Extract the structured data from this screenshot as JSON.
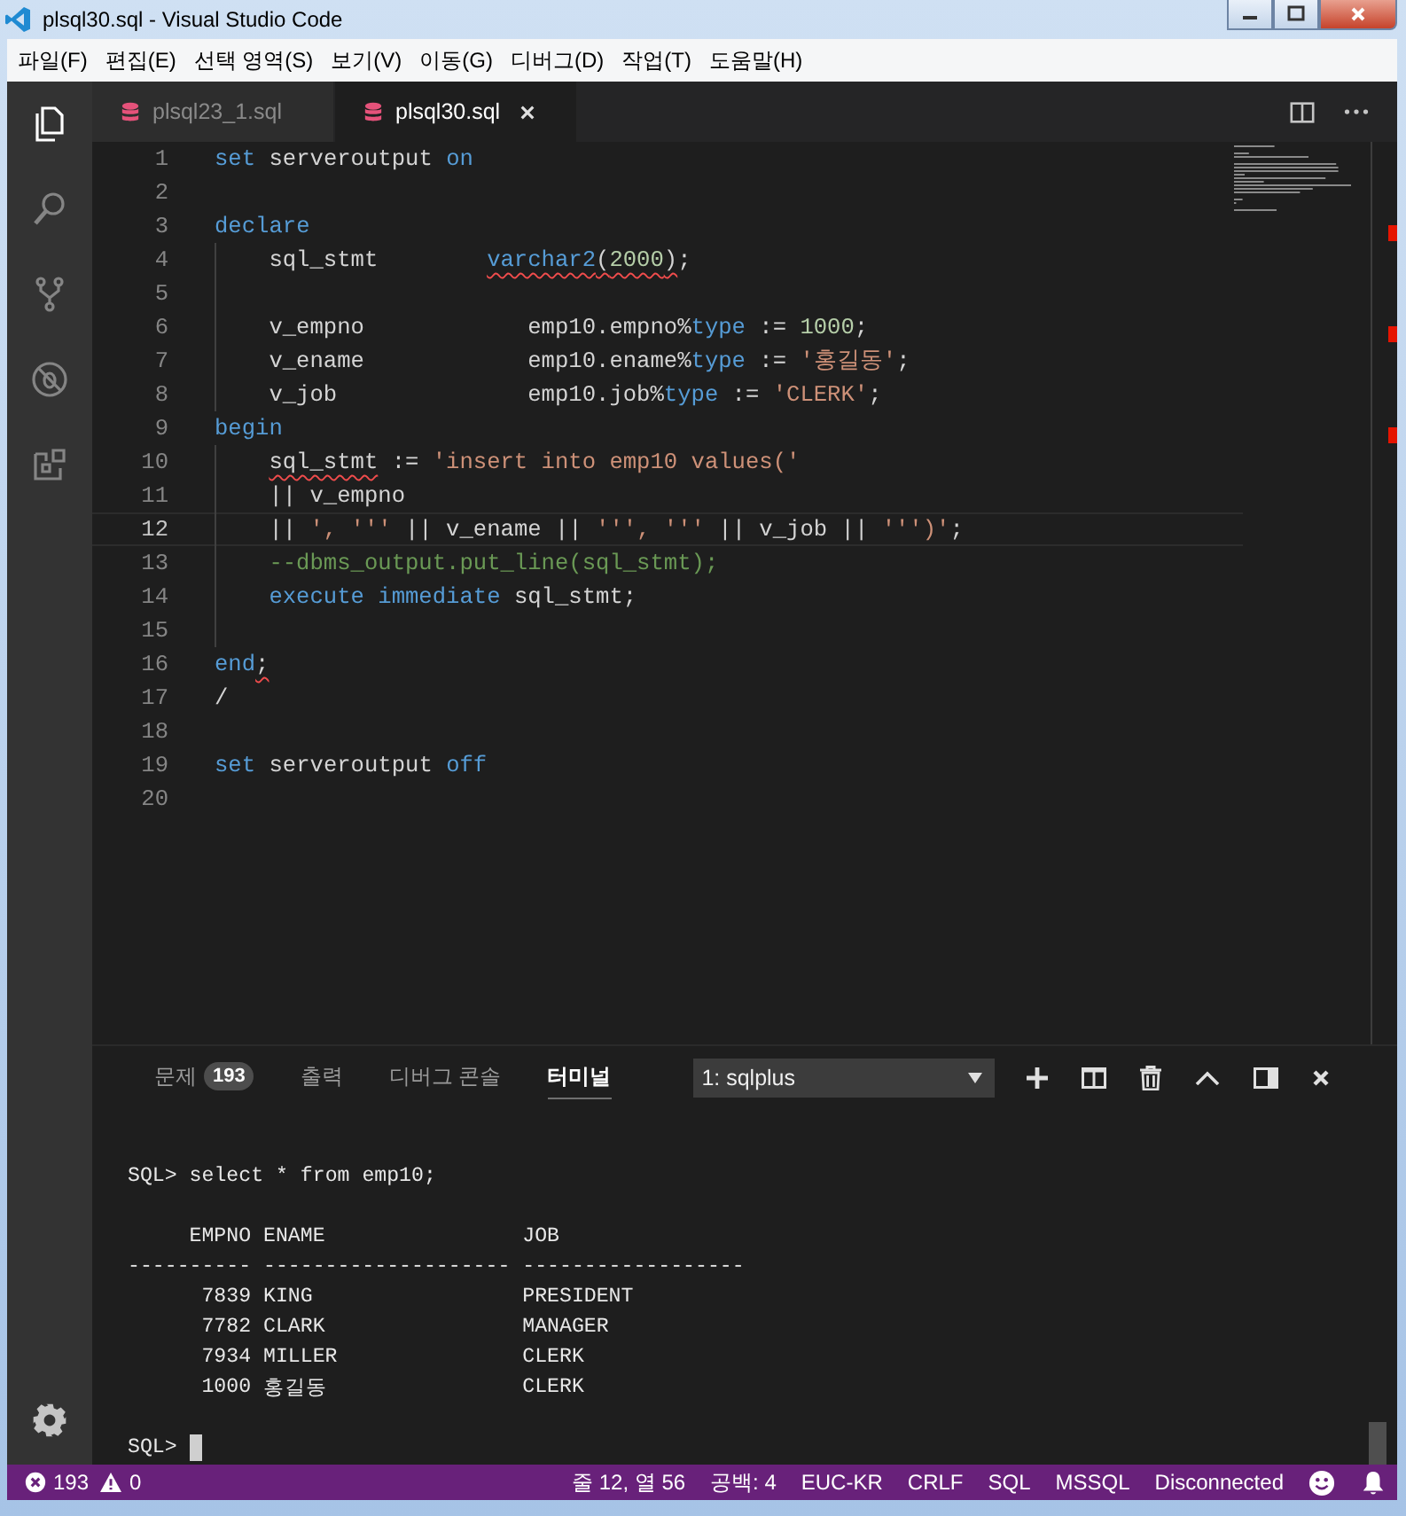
{
  "window": {
    "title": "plsql30.sql - Visual Studio Code"
  },
  "menu": [
    "파일(F)",
    "편집(E)",
    "선택 영역(S)",
    "보기(V)",
    "이동(G)",
    "디버그(D)",
    "작업(T)",
    "도움말(H)"
  ],
  "activity_bar": {
    "items": [
      {
        "selected": true
      },
      {
        "selected": false
      },
      {
        "selected": false
      },
      {
        "selected": false
      },
      {
        "selected": false
      }
    ]
  },
  "tabs": [
    {
      "label": "plsql23_1.sql",
      "selected": false
    },
    {
      "label": "plsql30.sql",
      "selected": true
    }
  ],
  "editor": {
    "lines": [
      {
        "n": "1",
        "current": false,
        "guide": false,
        "tokens": [
          {
            "t": "set",
            "kind": "kw",
            "error": false
          },
          {
            "t": " serveroutput ",
            "kind": "id",
            "error": false
          },
          {
            "t": "on",
            "kind": "kw",
            "error": false
          }
        ]
      },
      {
        "n": "2",
        "current": false,
        "guide": false
      },
      {
        "n": "3",
        "current": false,
        "guide": false,
        "tokens": [
          {
            "t": "declare",
            "kind": "kw",
            "error": false
          }
        ]
      },
      {
        "n": "4",
        "current": false,
        "guide": true,
        "tokens": [
          {
            "t": "sql_stmt        ",
            "kind": "id",
            "error": false
          },
          {
            "t": "varchar2",
            "kind": "kw",
            "error": true
          },
          {
            "t": "(",
            "kind": "id",
            "error": true
          },
          {
            "t": "2000",
            "kind": "num",
            "error": true
          },
          {
            "t": ")",
            "kind": "id",
            "error": true
          },
          {
            "t": ";",
            "kind": "id",
            "error": false
          }
        ]
      },
      {
        "n": "5",
        "current": false,
        "guide": true
      },
      {
        "n": "6",
        "current": false,
        "guide": true,
        "tokens": [
          {
            "t": "v_empno            emp10.empno%",
            "kind": "id",
            "error": false
          },
          {
            "t": "type",
            "kind": "kw",
            "error": false
          },
          {
            "t": " := ",
            "kind": "id",
            "error": false
          },
          {
            "t": "1000",
            "kind": "num",
            "error": false
          },
          {
            "t": ";",
            "kind": "id",
            "error": false
          }
        ]
      },
      {
        "n": "7",
        "current": false,
        "guide": true,
        "tokens": [
          {
            "t": "v_ename            emp10.ename%",
            "kind": "id",
            "error": false
          },
          {
            "t": "type",
            "kind": "kw",
            "error": false
          },
          {
            "t": " := ",
            "kind": "id",
            "error": false
          },
          {
            "t": "'홍길동'",
            "kind": "str",
            "error": false
          },
          {
            "t": ";",
            "kind": "id",
            "error": false
          }
        ]
      },
      {
        "n": "8",
        "current": false,
        "guide": true,
        "tokens": [
          {
            "t": "v_job              emp10.job%",
            "kind": "id",
            "error": false
          },
          {
            "t": "type",
            "kind": "kw",
            "error": false
          },
          {
            "t": " := ",
            "kind": "id",
            "error": false
          },
          {
            "t": "'CLERK'",
            "kind": "str",
            "error": false
          },
          {
            "t": ";",
            "kind": "id",
            "error": false
          }
        ]
      },
      {
        "n": "9",
        "current": false,
        "guide": false,
        "tokens": [
          {
            "t": "begin",
            "kind": "kw",
            "error": false
          }
        ]
      },
      {
        "n": "10",
        "current": false,
        "guide": true,
        "tokens": [
          {
            "t": "sql_stmt",
            "kind": "id",
            "error": true
          },
          {
            "t": " := ",
            "kind": "id",
            "error": false
          },
          {
            "t": "'insert into emp10 values('",
            "kind": "str",
            "error": false
          }
        ]
      },
      {
        "n": "11",
        "current": false,
        "guide": true,
        "tokens": [
          {
            "t": "|| v_empno",
            "kind": "id",
            "error": false
          }
        ]
      },
      {
        "n": "12",
        "current": true,
        "guide": true,
        "tokens": [
          {
            "t": "|| ",
            "kind": "id",
            "error": false
          },
          {
            "t": "', '''",
            "kind": "str",
            "error": false
          },
          {
            "t": " || v_ename || ",
            "kind": "id",
            "error": false
          },
          {
            "t": "''', '''",
            "kind": "str",
            "error": false
          },
          {
            "t": " || v_job || ",
            "kind": "id",
            "error": false
          },
          {
            "t": "''')'",
            "kind": "str",
            "error": false
          },
          {
            "t": ";",
            "kind": "id",
            "error": false
          }
        ]
      },
      {
        "n": "13",
        "current": false,
        "guide": true,
        "tokens": [
          {
            "t": "--dbms_output.put_line(sql_stmt);",
            "kind": "cmt",
            "error": false
          }
        ]
      },
      {
        "n": "14",
        "current": false,
        "guide": true,
        "tokens": [
          {
            "t": "execute immediate",
            "kind": "kw",
            "error": false
          },
          {
            "t": " sql_stmt;",
            "kind": "id",
            "error": false
          }
        ]
      },
      {
        "n": "15",
        "current": false,
        "guide": true
      },
      {
        "n": "16",
        "current": false,
        "guide": false,
        "tokens": [
          {
            "t": "end",
            "kind": "kw",
            "error": false
          },
          {
            "t": ";",
            "kind": "id",
            "error": true
          }
        ]
      },
      {
        "n": "17",
        "current": false,
        "guide": false,
        "tokens": [
          {
            "t": "/",
            "kind": "id",
            "error": false
          }
        ]
      },
      {
        "n": "18",
        "current": false,
        "guide": false
      },
      {
        "n": "19",
        "current": false,
        "guide": false,
        "tokens": [
          {
            "t": "set",
            "kind": "kw",
            "error": false
          },
          {
            "t": " serveroutput ",
            "kind": "id",
            "error": false
          },
          {
            "t": "off",
            "kind": "kw",
            "error": false
          }
        ]
      },
      {
        "n": "20",
        "current": false,
        "guide": false
      }
    ]
  },
  "panel": {
    "tabs": [
      {
        "label": "문제",
        "badge": "193",
        "selected": false
      },
      {
        "label": "출력",
        "selected": false
      },
      {
        "label": "디버그 콘솔",
        "selected": false
      },
      {
        "label": "터미널",
        "selected": true
      }
    ],
    "terminal_select": {
      "value": "1: sqlplus"
    },
    "terminal": [
      {
        "kind": "text",
        "text": "SQL> select * from emp10;"
      },
      {
        "kind": "blank"
      },
      {
        "kind": "row",
        "cells": [
          "EMPNO",
          "ENAME",
          "JOB"
        ]
      },
      {
        "kind": "row",
        "cells": [
          "----------",
          "--------------------",
          "------------------"
        ]
      },
      {
        "kind": "row",
        "cells": [
          "7839",
          "KING",
          "PRESIDENT"
        ]
      },
      {
        "kind": "row",
        "cells": [
          "7782",
          "CLARK",
          "MANAGER"
        ]
      },
      {
        "kind": "row",
        "cells": [
          "7934",
          "MILLER",
          "CLERK"
        ]
      },
      {
        "kind": "row",
        "cells": [
          "1000",
          "홍길동",
          "CLERK"
        ]
      },
      {
        "kind": "blank"
      },
      {
        "kind": "prompt",
        "text": "SQL>"
      }
    ]
  },
  "status_bar": {
    "errors": "193",
    "warnings": "0",
    "items": [
      "줄 12, 열 56",
      "공백: 4",
      "EUC-KR",
      "CRLF",
      "SQL",
      "MSSQL",
      "Disconnected"
    ]
  }
}
